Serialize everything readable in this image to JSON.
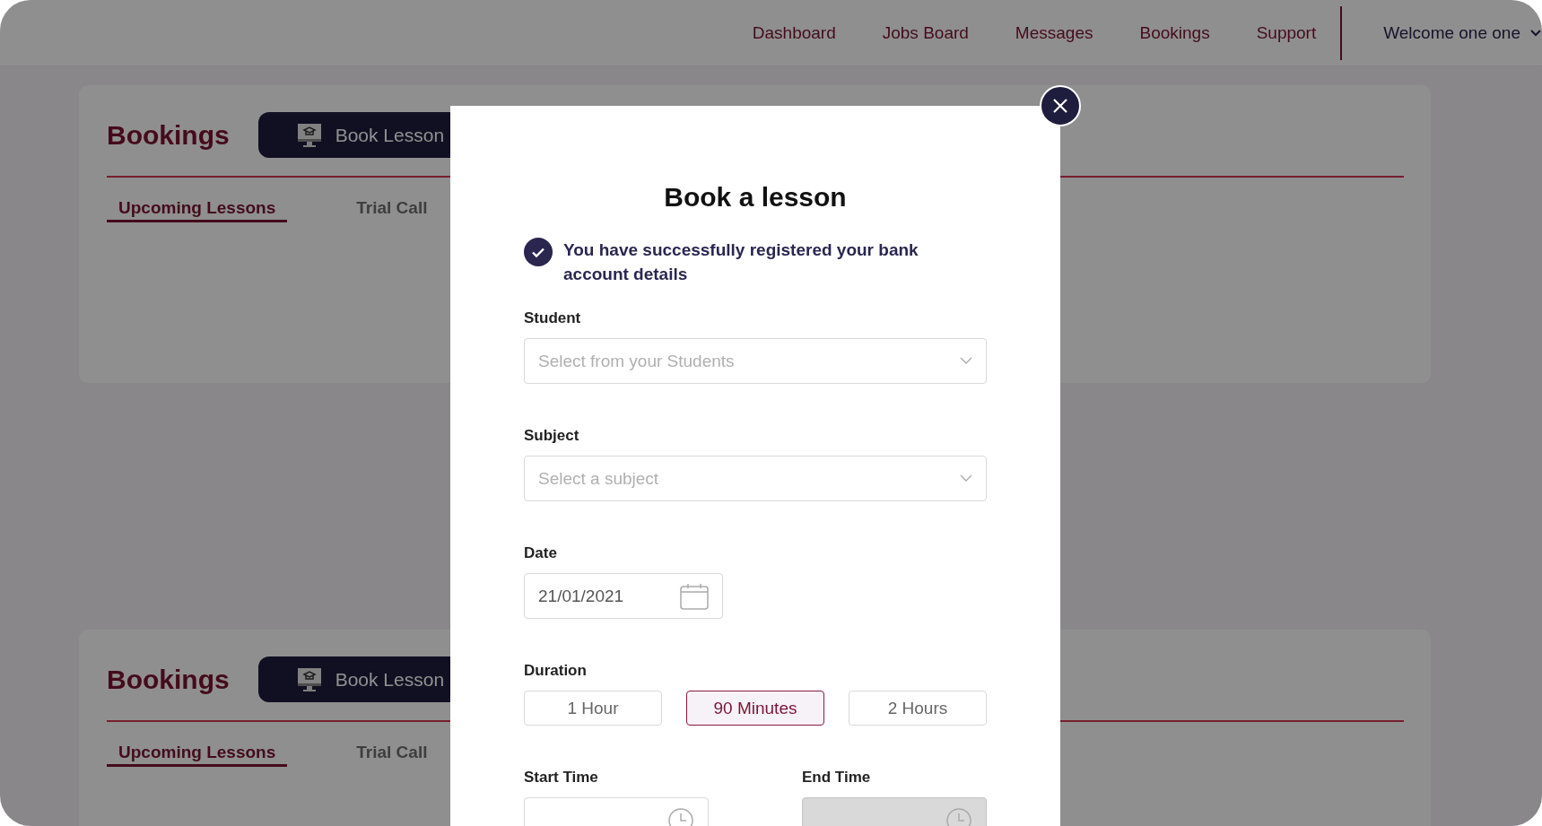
{
  "nav": {
    "items": [
      {
        "label": "Dashboard"
      },
      {
        "label": "Jobs Board"
      },
      {
        "label": "Messages"
      },
      {
        "label": "Bookings"
      },
      {
        "label": "Support"
      }
    ],
    "user": "Welcome one one"
  },
  "sections": [
    {
      "title": "Bookings",
      "button": "Book Lesson",
      "tabs": [
        {
          "label": "Upcoming Lessons",
          "selected": true
        },
        {
          "label": "Trial Call",
          "selected": false
        }
      ]
    },
    {
      "title": "Bookings",
      "button": "Book Lesson",
      "tabs": [
        {
          "label": "Upcoming Lessons",
          "selected": true
        },
        {
          "label": "Trial Call",
          "selected": false
        }
      ]
    }
  ],
  "modal": {
    "title": "Book a lesson",
    "notice": "You have successfully registered your bank account details",
    "student": {
      "label": "Student",
      "placeholder": "Select from your Students"
    },
    "subject": {
      "label": "Subject",
      "placeholder": "Select a subject"
    },
    "date": {
      "label": "Date",
      "value": "21/01/2021"
    },
    "duration": {
      "label": "Duration",
      "options": [
        {
          "label": "1 Hour",
          "selected": false
        },
        {
          "label": "90 Minutes",
          "selected": true
        },
        {
          "label": "2 Hours",
          "selected": false
        }
      ]
    },
    "times": [
      {
        "label": "Start Time",
        "disabled": false
      },
      {
        "label": "End Time",
        "disabled": true
      }
    ]
  }
}
